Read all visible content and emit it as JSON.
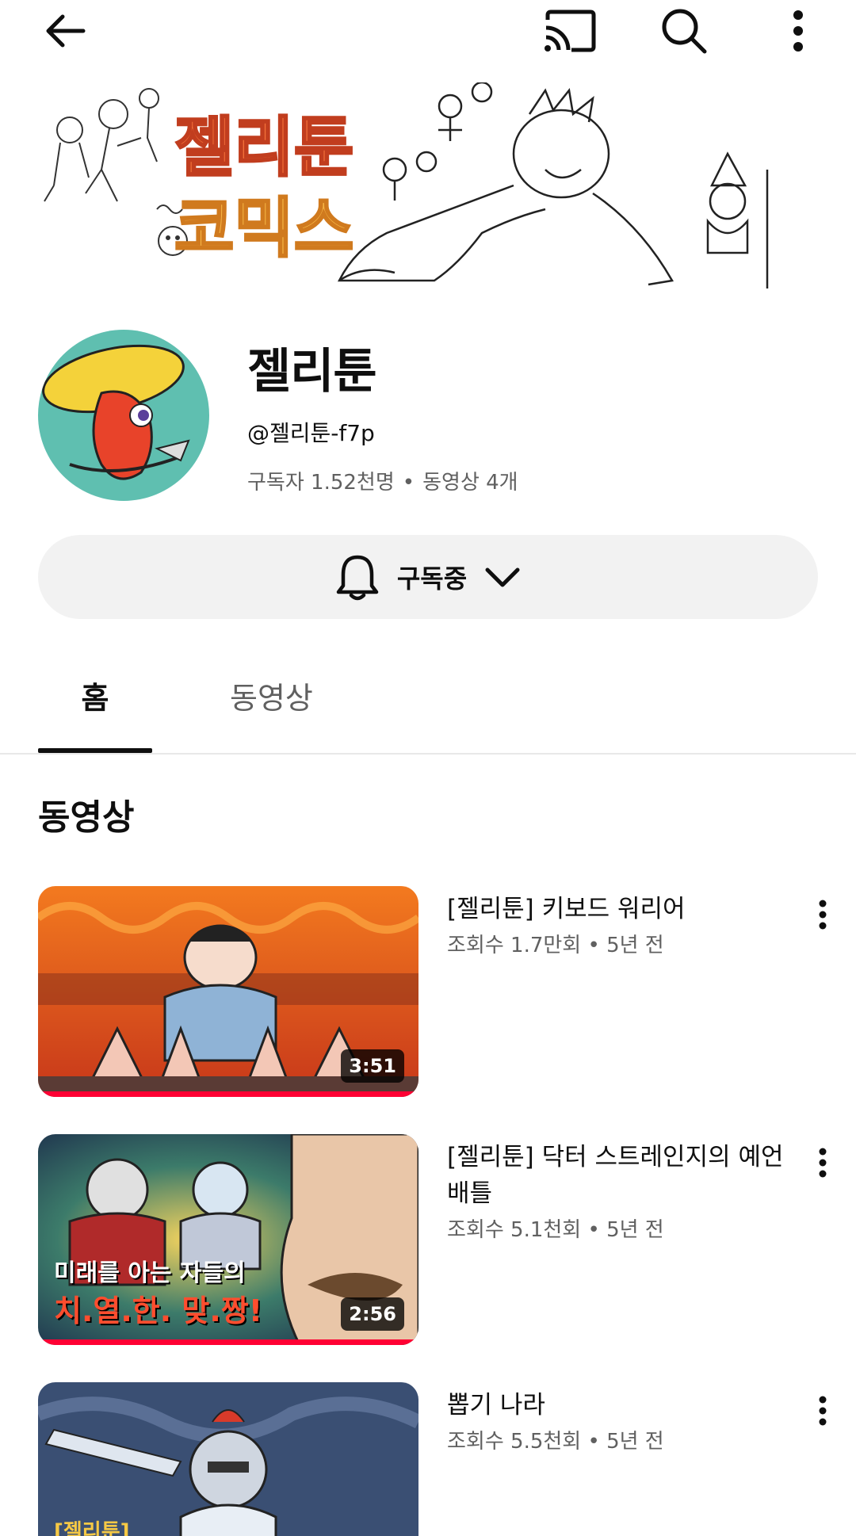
{
  "topbar": {
    "back_icon": "arrow-back-icon",
    "cast_icon": "cast-icon",
    "search_icon": "search-icon",
    "more_icon": "more-vertical-icon"
  },
  "banner": {
    "title_line1": "젤리툰",
    "title_line2": "코믹스"
  },
  "channel": {
    "name": "젤리툰",
    "handle": "@젤리툰-f7p",
    "subscribers": "구독자 1.52천명",
    "videos_count": "동영상 4개",
    "separator": "•"
  },
  "subscribe": {
    "label": "구독중",
    "bell_icon": "bell-icon",
    "chevron_icon": "chevron-down-icon"
  },
  "tabs": [
    {
      "label": "홈",
      "active": true
    },
    {
      "label": "동영상",
      "active": false
    }
  ],
  "section": {
    "title": "동영상"
  },
  "videos": [
    {
      "title": "[젤리툰] 키보드 워리어",
      "meta": "조회수 1.7만회 • 5년 전",
      "duration": "3:51",
      "watched_fraction": 1.0
    },
    {
      "title": "[젤리툰] 닥터 스트레인지의 예언 배틀",
      "meta": "조회수 5.1천회 • 5년 전",
      "duration": "2:56",
      "watched_fraction": 1.0,
      "thumb_text_line1": "미래를 아는 자들의",
      "thumb_text_line2": "치.열.한. 맞.짱!"
    },
    {
      "title": "뽑기 나라",
      "meta": "조회수 5.5천회 • 5년 전",
      "thumb_tag": "[젤리툰]"
    }
  ],
  "colors": {
    "accent": "#ff0033",
    "text_primary": "#0f0f0f",
    "text_secondary": "#606060",
    "button_bg": "#f2f2f2"
  }
}
